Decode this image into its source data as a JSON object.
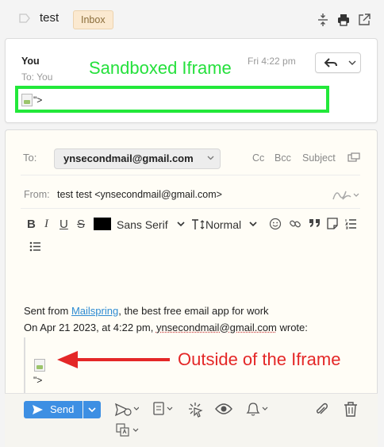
{
  "thread": {
    "subject": "test",
    "badge": "Inbox"
  },
  "message": {
    "from": "You",
    "to": "To: You",
    "date": "Fri 4:22 pm",
    "iframe_content": "\">"
  },
  "annotations": {
    "sandboxed": "Sandboxed Iframe",
    "outside": "Outside of the Iframe",
    "sandbox_color": "#22e83a",
    "outside_color": "#e42727"
  },
  "composer": {
    "to_label": "To:",
    "to_recipient": "ynsecondmail@gmail.com",
    "cc": "Cc",
    "bcc": "Bcc",
    "subject_toggle": "Subject",
    "from_label": "From:",
    "from_value": "test test <ynsecondmail@gmail.com>",
    "toolbar": {
      "bold": "B",
      "italic": "I",
      "underline": "U",
      "strike": "S",
      "font": "Sans Serif",
      "size": "Normal"
    },
    "body": {
      "sig_prefix": "Sent from ",
      "sig_link": "Mailspring",
      "sig_suffix": ", the best free email app for work",
      "quote_prefix": "On Apr 21 2023, at 4:22 pm, ",
      "quote_email": "ynsecondmail@gmail.com",
      "quote_suffix": " wrote:",
      "quoted_text": "\">"
    },
    "send_label": "Send",
    "accent": "#3d8fe3"
  }
}
